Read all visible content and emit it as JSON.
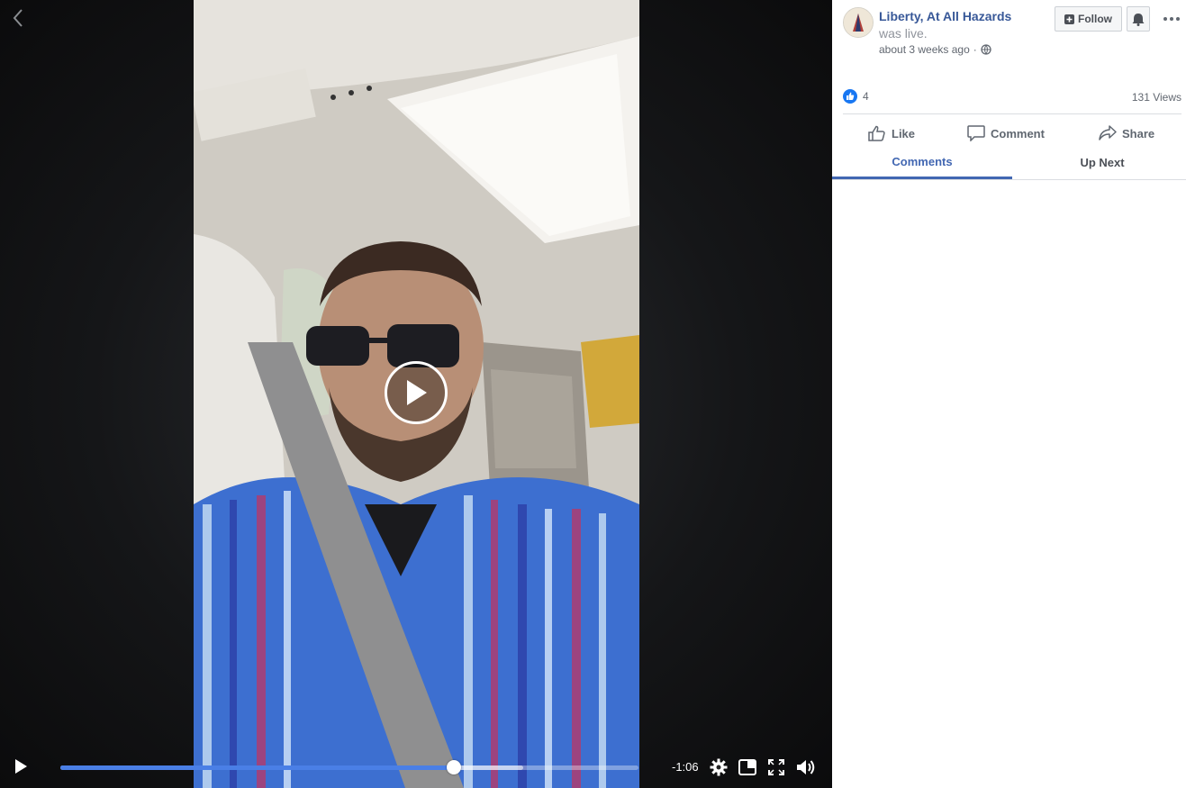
{
  "player": {
    "time_remaining": "-1:06",
    "progress_played": 0.68,
    "progress_buffered": 0.8
  },
  "post": {
    "page_name": "Liberty, At All Hazards",
    "status": "was live.",
    "timestamp": "about 3 weeks ago",
    "separator": "·",
    "follow_label": "Follow",
    "reactions_count": "4",
    "views": "131 Views"
  },
  "actions": {
    "like": "Like",
    "comment": "Comment",
    "share": "Share"
  },
  "tabs": [
    {
      "label": "Comments",
      "active": true
    },
    {
      "label": "Up Next",
      "active": false
    }
  ],
  "colors": {
    "link_blue": "#385898",
    "accent_blue": "#4267b2",
    "progress_blue": "#4a7fe6"
  }
}
